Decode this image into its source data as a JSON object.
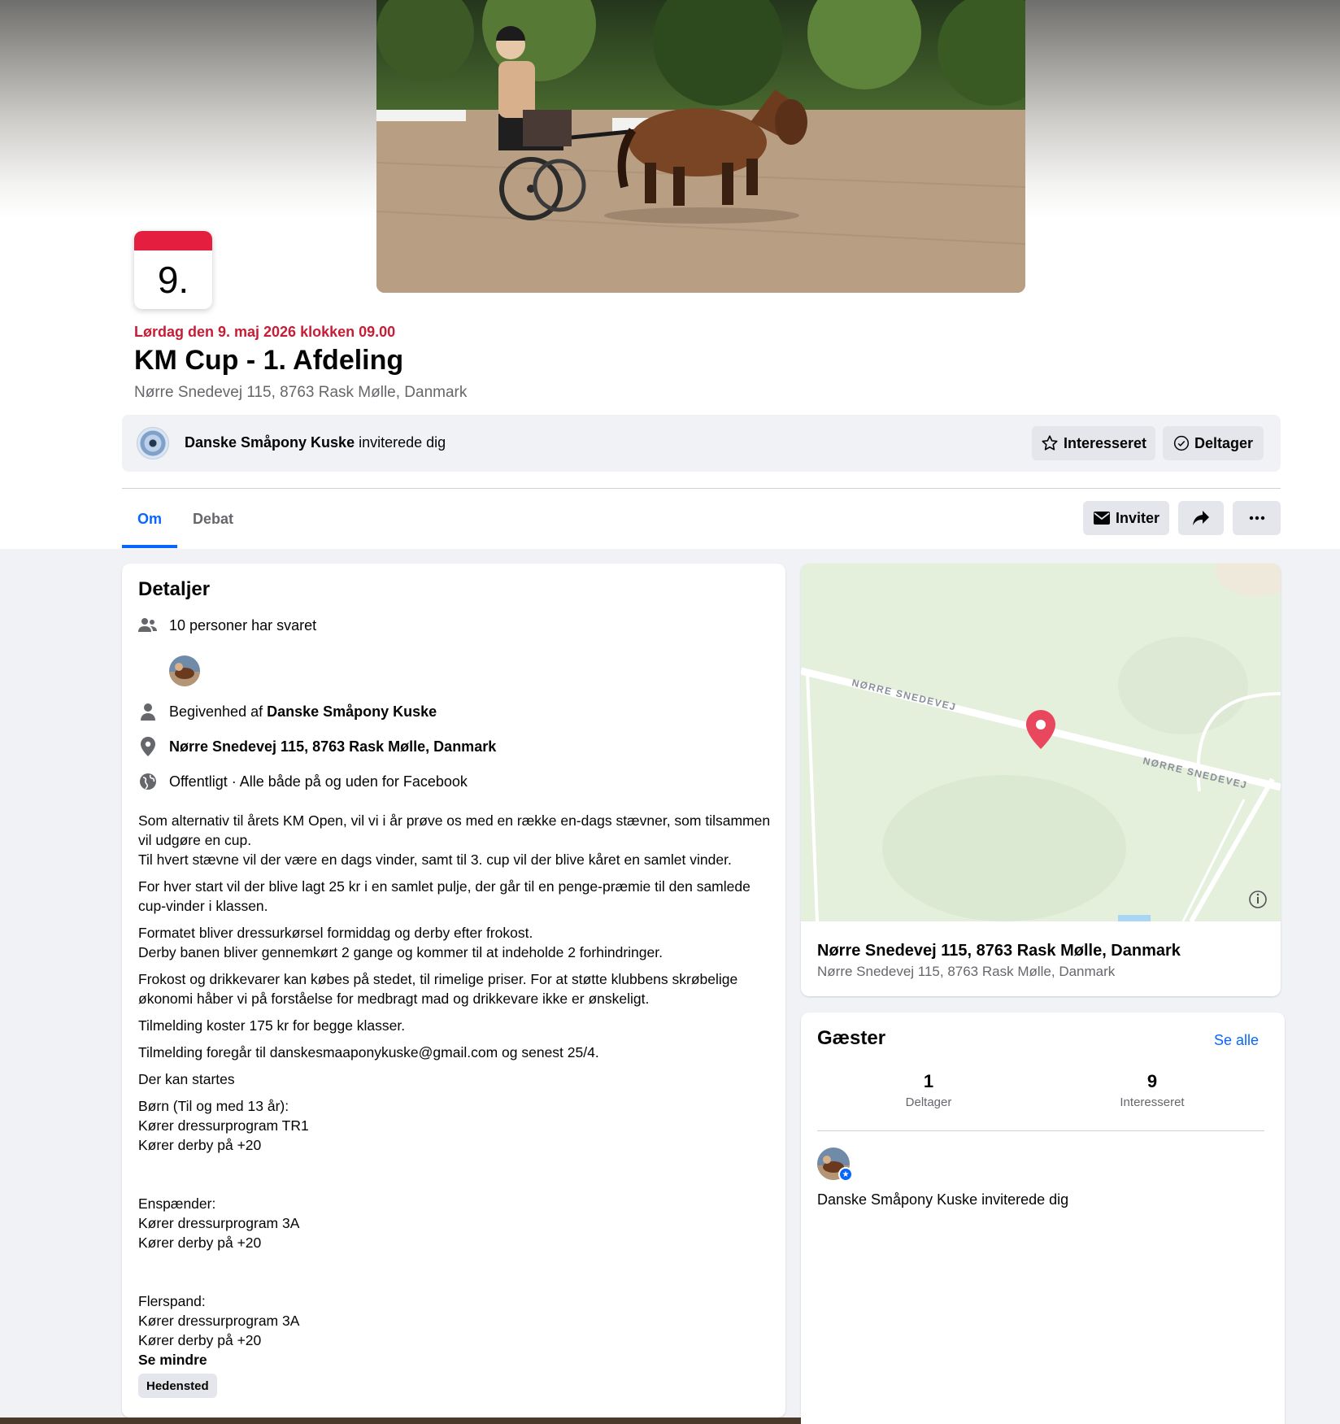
{
  "event": {
    "calendar_day": "9.",
    "date_text": "Lørdag den 9. maj 2026 klokken 09.00",
    "title": "KM Cup - 1. Afdeling",
    "location": "Nørre Snedevej 115, 8763 Rask Mølle, Danmark"
  },
  "invite": {
    "host_name": "Danske Småpony Kuske",
    "invited_text": " inviterede dig",
    "interested_label": "Interesseret",
    "going_label": "Deltager"
  },
  "tabs": [
    {
      "label": "Om",
      "active": true
    },
    {
      "label": "Debat",
      "active": false
    }
  ],
  "actions": {
    "invite_label": "Inviter",
    "share_icon": "share-icon",
    "more_icon": "more-icon"
  },
  "details": {
    "heading": "Detaljer",
    "responded": "10 personer har svaret",
    "organizer_prefix": "Begivenhed af ",
    "organizer_name": "Danske Småpony Kuske",
    "address": "Nørre Snedevej 115, 8763 Rask Mølle, Danmark",
    "privacy": "Offentligt · Alle både på og uden for Facebook",
    "description": [
      "Som alternativ til årets KM Open, vil vi i år prøve os med en række en-dags stævner, som tilsammen vil udgøre en cup.\nTil hvert stævne vil der være en dags vinder, samt til 3. cup vil der blive kåret en samlet vinder.",
      "For hver start vil der blive lagt 25 kr i en samlet pulje, der går til en penge-præmie til den samlede cup-vinder i klassen.",
      "Formatet bliver dressurkørsel formiddag og derby efter frokost.\nDerby banen bliver gennemkørt 2 gange og kommer til at indeholde 2 forhindringer.",
      "Frokost og drikkevarer kan købes på stedet, til rimelige priser. For at støtte klubbens skrøbelige økonomi håber vi på forståelse for medbragt mad og drikkevare ikke er ønskeligt.",
      "Tilmelding koster 175 kr for begge klasser.",
      "Tilmelding foregår til danskesmaaponykuske@gmail.com og senest 25/4.",
      "Der kan startes",
      "Børn (Til og med 13 år):\nKører dressurprogram TR1\nKører derby på +20\n\n\nEnspænder:\nKører dressurprogram 3A\nKører derby på +20\n\n\nFlerspand:\nKører dressurprogram 3A\nKører derby på +20"
    ],
    "see_less": "Se mindre",
    "tag": "Hedensted"
  },
  "map": {
    "road_label_1": "NØRRE SNEDEVEJ",
    "road_label_2": "NØRRE SNEDEVEJ",
    "title": "Nørre Snedevej 115, 8763 Rask Mølle, Danmark",
    "subtitle": "Nørre Snedevej 115, 8763 Rask Mølle, Danmark"
  },
  "guests": {
    "heading": "Gæster",
    "see_all": "Se alle",
    "going_count": "1",
    "going_label": "Deltager",
    "interested_count": "9",
    "interested_label": "Interesseret",
    "invite_text": "Danske Småpony Kuske inviterede dig"
  },
  "colors": {
    "accent": "#0866ff",
    "date_red": "#c61d36",
    "calendar_red": "#e41e3f",
    "map_pin": "#e8475d"
  }
}
